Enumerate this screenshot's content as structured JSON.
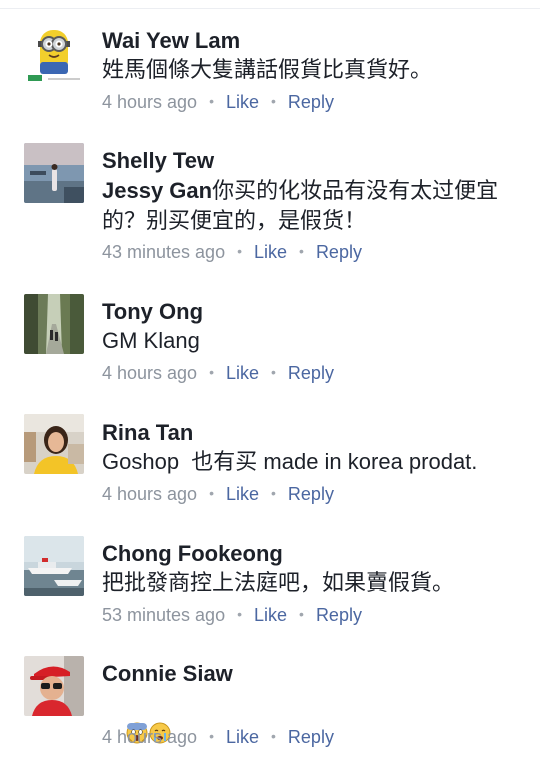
{
  "comments": [
    {
      "name": "Wai Yew Lam",
      "text": "姓馬個條大隻講話假貨比真貨好。",
      "time": "4 hours ago",
      "like": "Like",
      "reply": "Reply",
      "avatar": "minion-avatar"
    },
    {
      "name": "Shelly  Tew",
      "mention": "Jessy Gan",
      "text": "你买的化妆品有没有太过便宜的？别买便宜的，是假货！",
      "time": "43 minutes ago",
      "like": "Like",
      "reply": "Reply",
      "avatar": "beach-photo-avatar"
    },
    {
      "name": "Tony Ong",
      "text": "GM Klang",
      "time": "4 hours ago",
      "like": "Like",
      "reply": "Reply",
      "avatar": "forest-path-avatar"
    },
    {
      "name": "Rina Tan",
      "text": "Goshop  也有买 made in korea prodat.",
      "time": "4 hours ago",
      "like": "Like",
      "reply": "Reply",
      "avatar": "woman-portrait-avatar"
    },
    {
      "name": "Chong Fookeong",
      "text": "把批發商控上法庭吧，如果賣假貨。",
      "time": "53 minutes ago",
      "like": "Like",
      "reply": "Reply",
      "avatar": "boats-harbor-avatar"
    },
    {
      "name": "Connie Siaw",
      "text": "",
      "emojis": [
        "screaming-face-emoji",
        "crying-face-emoji"
      ],
      "time": "4 hours ago",
      "like": "Like",
      "reply": "Reply",
      "avatar": "red-cap-woman-avatar"
    }
  ],
  "colors": {
    "name": "#1d2129",
    "meta": "#8d949e",
    "action": "#4b67a1"
  }
}
